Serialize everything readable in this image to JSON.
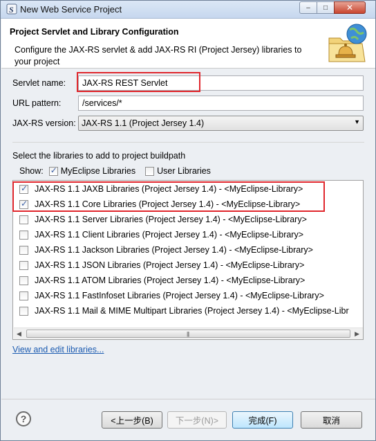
{
  "window": {
    "title": "New Web Service Project",
    "controls": {
      "minimize": "–",
      "maximize": "□",
      "close": "✕"
    }
  },
  "header": {
    "heading": "Project Servlet and Library Configuration",
    "description": "Configure the JAX-RS servlet & add JAX-RS RI (Project Jersey) libraries to your project",
    "banner_icon": "web-service-globe-bell-icon"
  },
  "form": {
    "servlet_name_label": "Servlet name:",
    "servlet_name_value": "JAX-RS REST Servlet",
    "url_pattern_label": "URL pattern:",
    "url_pattern_value": "/services/*",
    "jaxrs_version_label": "JAX-RS version:",
    "jaxrs_version_value": "JAX-RS 1.1 (Project Jersey 1.4)"
  },
  "libraries": {
    "section_label": "Select the libraries to add to project buildpath",
    "show_label": "Show:",
    "filters": [
      {
        "label": "MyEclipse Libraries",
        "checked": true
      },
      {
        "label": "User Libraries",
        "checked": false
      }
    ],
    "items": [
      {
        "label": "JAX-RS 1.1 JAXB Libraries (Project Jersey 1.4) - <MyEclipse-Library>",
        "checked": true
      },
      {
        "label": "JAX-RS 1.1 Core Libraries (Project Jersey 1.4) - <MyEclipse-Library>",
        "checked": true
      },
      {
        "label": "JAX-RS 1.1 Server Libraries (Project Jersey 1.4) - <MyEclipse-Library>",
        "checked": false
      },
      {
        "label": "JAX-RS 1.1 Client Libraries (Project Jersey 1.4) - <MyEclipse-Library>",
        "checked": false
      },
      {
        "label": "JAX-RS 1.1 Jackson Libraries (Project Jersey 1.4) - <MyEclipse-Library>",
        "checked": false
      },
      {
        "label": "JAX-RS 1.1 JSON Libraries (Project Jersey 1.4) - <MyEclipse-Library>",
        "checked": false
      },
      {
        "label": "JAX-RS 1.1 ATOM Libraries (Project Jersey 1.4) - <MyEclipse-Library>",
        "checked": false
      },
      {
        "label": "JAX-RS 1.1 FastInfoset Libraries (Project Jersey 1.4) - <MyEclipse-Library>",
        "checked": false
      },
      {
        "label": "JAX-RS 1.1 Mail & MIME Multipart Libraries (Project Jersey 1.4) - <MyEclipse-Libr",
        "checked": false
      }
    ],
    "edit_link": "View and edit libraries..."
  },
  "buttons": {
    "help": "?",
    "back": "<上一步(B)",
    "next": "下一步(N)>",
    "finish": "完成(F)",
    "cancel": "取消"
  },
  "colors": {
    "highlight": "#e0262c",
    "link": "#1a5ab0"
  }
}
